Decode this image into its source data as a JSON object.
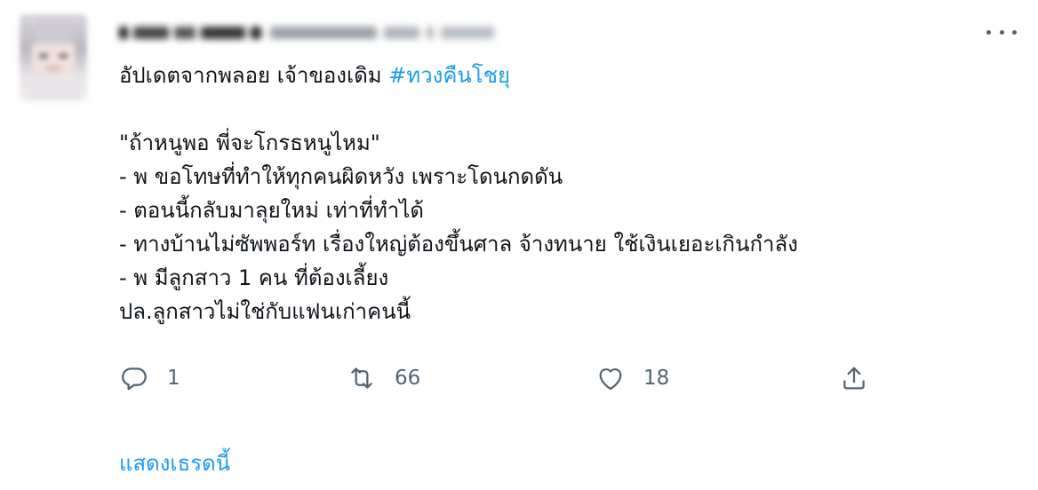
{
  "tweet": {
    "author_handle_blurred": "",
    "first_line": {
      "text": "อัปเดตจากพลอย เจ้าของเดิม ",
      "hashtag": "#ทวงคืนโชยุ"
    },
    "lines": [
      "\"ถ้าหนูพอ พี่จะโกรธหนูไหม\"",
      "- พ ขอโทษที่ทำให้ทุกคนผิดหวัง เพราะโดนกดดัน",
      "- ตอนนี้กลับมาลุยใหม่ เท่าที่ทำได้",
      "- ทางบ้านไม่ซัพพอร์ท เรื่องใหญ่ต้องขึ้นศาล จ้างทนาย ใช้เงินเยอะเกินกำลัง",
      "- พ มีลูกสาว 1 คน ที่ต้องเลี้ยง",
      "ปล.ลูกสาวไม่ใช่กับแฟนเก่าคนนี้"
    ]
  },
  "actions": {
    "reply_count": "1",
    "retweet_count": "66",
    "like_count": "18"
  },
  "icons": {
    "reply": "reply-icon",
    "retweet": "retweet-icon",
    "like": "heart-icon",
    "share": "share-icon",
    "more": "more-icon"
  },
  "show_thread": "แสดงเธรดนี้",
  "colors": {
    "link": "#1d9bf0",
    "text": "#0f1419",
    "muted": "#536471"
  }
}
